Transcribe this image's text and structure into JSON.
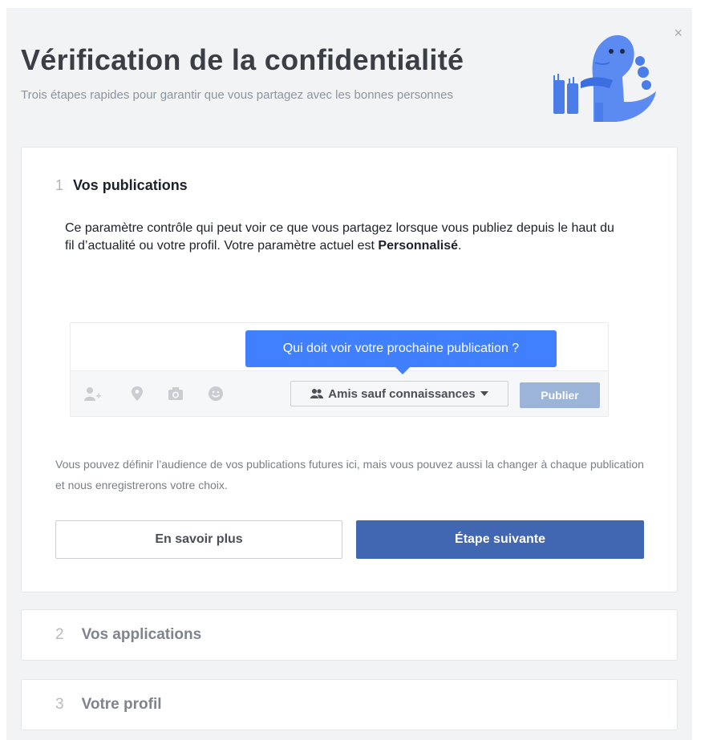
{
  "dialog": {
    "close_label": "×",
    "title": "Vérification de la confidentialité",
    "subtitle": "Trois étapes rapides pour garantir que vous partagez avec les bonnes personnes"
  },
  "steps": [
    {
      "number": "1",
      "title": "Vos publications",
      "description_part1": "Ce paramètre contrôle qui peut voir ce que vous partagez lorsque vous publiez depuis le haut du fil d’actualité ou votre profil. Votre paramètre actuel est ",
      "description_bold": "Personnalisé",
      "description_end": ".",
      "tooltip": "Qui doit voir votre prochaine publication ?",
      "audience_label": "Amis sauf connaissances",
      "post_label": "Publier",
      "note": "Vous pouvez définir l’audience de vos publications futures ici, mais vous pouvez aussi la changer à chaque publication et nous enregistrerons votre choix.",
      "learn_more_label": "En savoir plus",
      "next_label": "Étape suivante"
    },
    {
      "number": "2",
      "title": "Vos applications"
    },
    {
      "number": "3",
      "title": "Votre profil"
    }
  ],
  "icons": [
    "tag-friends-icon",
    "location-icon",
    "camera-icon",
    "emoji-icon",
    "friends-icon",
    "dropdown-caret-icon",
    "close-icon",
    "dinosaur-mascot-icon"
  ],
  "colors": {
    "accent": "#4267b2",
    "tooltip": "#4080ff",
    "post_button": "#9cb4d8"
  }
}
